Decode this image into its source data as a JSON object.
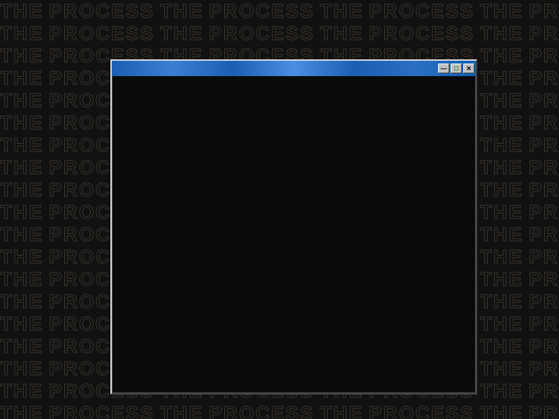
{
  "background": {
    "text_items": [
      "THE",
      "PROCESS"
    ],
    "rows": 18,
    "cols": 6
  },
  "window": {
    "title": "",
    "controls": {
      "minimize": "—",
      "maximize": "□",
      "close": "✕"
    }
  }
}
